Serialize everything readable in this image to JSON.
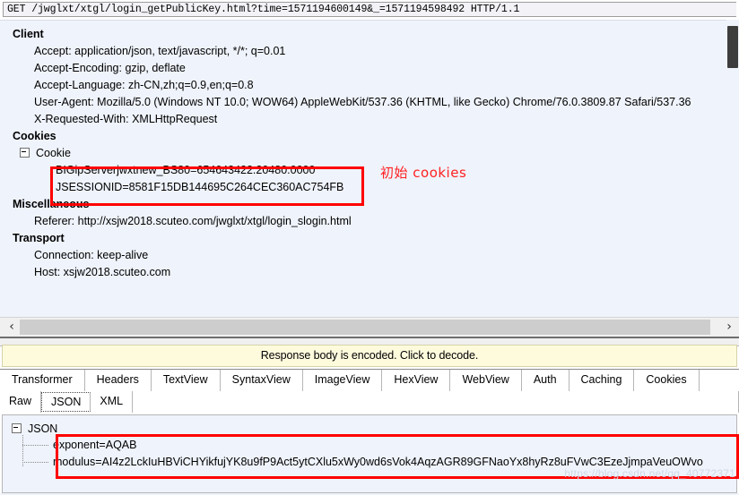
{
  "app": "Fiddler Web Debugger - Inspectors",
  "request_line": "GET /jwglxt/xtgl/login_getPublicKey.html?time=1571194600149&_=1571194598492 HTTP/1.1",
  "headers_tree": {
    "groups": [
      {
        "name": "Client",
        "headers": [
          "Accept: application/json, text/javascript, */*; q=0.01",
          "Accept-Encoding: gzip, deflate",
          "Accept-Language: zh-CN,zh;q=0.9,en;q=0.8",
          "User-Agent: Mozilla/5.0 (Windows NT 10.0; WOW64) AppleWebKit/537.36 (KHTML, like Gecko) Chrome/76.0.3809.87 Safari/537.36",
          "X-Requested-With: XMLHttpRequest"
        ]
      },
      {
        "name": "Cookies",
        "node_label": "Cookie",
        "cookie_values": [
          "BIGipServerjwxtnew_BS80=654643422.20480.0000",
          "JSESSIONID=8581F15DB144695C264CEC360AC754FB"
        ]
      },
      {
        "name": "Miscellaneous",
        "headers": [
          "Referer: http://xsjw2018.scuteo.com/jwglxt/xtgl/login_slogin.html"
        ]
      },
      {
        "name": "Transport",
        "headers": [
          "Connection: keep-alive",
          "Host: xsjw2018.scuteo.com"
        ]
      }
    ]
  },
  "scrollbar": {
    "left_arrow": "‹",
    "right_arrow": "›"
  },
  "encoded_notice": "Response body is encoded. Click to decode.",
  "response_tabs": {
    "row1": [
      "Transformer",
      "Headers",
      "TextView",
      "SyntaxView",
      "ImageView",
      "HexView",
      "WebView",
      "Auth",
      "Caching",
      "Cookies"
    ],
    "row2": [
      "Raw",
      "JSON",
      "XML"
    ],
    "row2_selected": "JSON"
  },
  "json_tree": {
    "root": "JSON",
    "entries": [
      "exponent=AQAB",
      "modulus=AI4z2LckIuHBViCHYikfujYK8u9fP9Act5ytCXlu5xWy0wd6sVok4AqzAGR89GFNaoYx8hyRz8uFVwC3EzeJjmpaVeuOWvo"
    ]
  },
  "annotations": {
    "cookies_note": "初始 cookies",
    "highlight_color": "#ff0000"
  },
  "watermark": "https://blog.csdn.net/qq_40772371"
}
